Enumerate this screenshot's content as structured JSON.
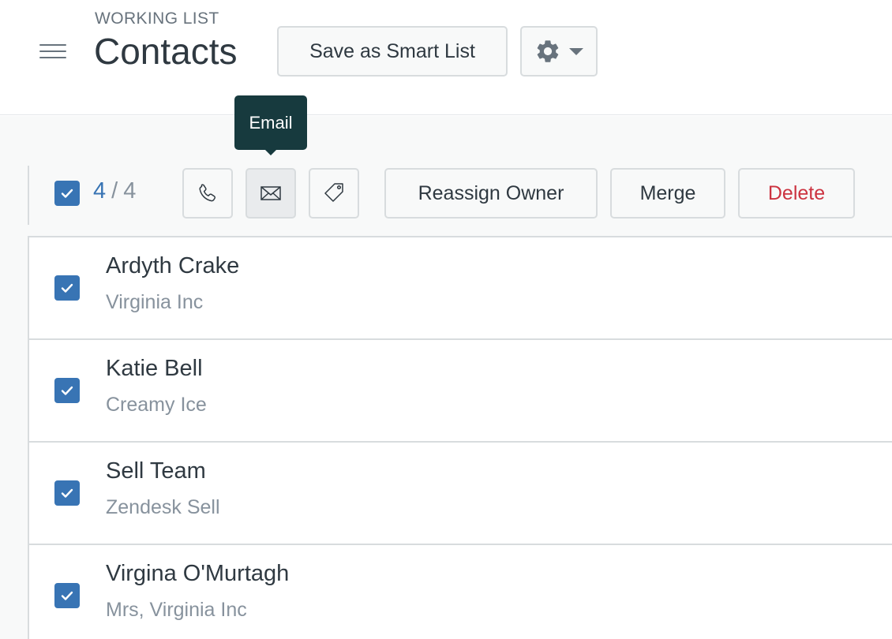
{
  "header": {
    "eyebrow": "WORKING LIST",
    "title": "Contacts",
    "save_smart_list_label": "Save as Smart List",
    "settings_icon": "gear-icon"
  },
  "tooltip": {
    "text": "Email"
  },
  "bulk_bar": {
    "selected_count": "4",
    "separator": "/",
    "total_count": "4",
    "icons": [
      "phone-icon",
      "envelope-icon",
      "tag-icon"
    ],
    "reassign_label": "Reassign Owner",
    "merge_label": "Merge",
    "delete_label": "Delete"
  },
  "contacts": [
    {
      "name": "Ardyth Crake",
      "company": "Virginia Inc",
      "checked": true
    },
    {
      "name": "Katie Bell",
      "company": "Creamy Ice",
      "checked": true
    },
    {
      "name": "Sell Team",
      "company": "Zendesk Sell",
      "checked": true
    },
    {
      "name": "Virgina O'Murtagh",
      "company": "Mrs, Virginia Inc",
      "checked": true
    }
  ],
  "colors": {
    "accent": "#3874b4",
    "delete": "#cc3340",
    "tooltip_bg": "#173a3e",
    "border": "#d8dcde"
  }
}
